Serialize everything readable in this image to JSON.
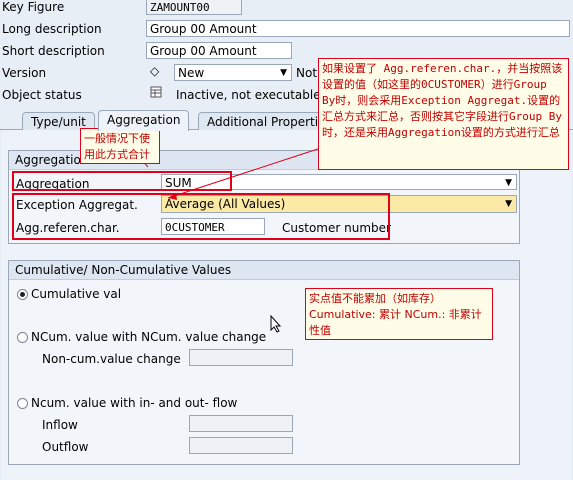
{
  "header": {
    "key_figure_label": "Key Figure",
    "key_figure_value": "ZAMOUNT00",
    "long_desc_label": "Long description",
    "long_desc_value": "Group 00 Amount",
    "short_desc_label": "Short description",
    "short_desc_value": "Group 00 Amount",
    "version_label": "Version",
    "version_value": "New",
    "version_extra": "Not",
    "object_status_label": "Object status",
    "object_status_value": "Inactive, not executable"
  },
  "tabs": [
    {
      "label": "Type/unit"
    },
    {
      "label": "Aggregation"
    },
    {
      "label": "Additional Properties"
    }
  ],
  "aggregation": {
    "title": "Aggregation",
    "aggregation_label": "Aggregation",
    "aggregation_value": "SUM",
    "exception_label": "Exception Aggregat.",
    "exception_value": "Average (All Values)",
    "ref_char_label": "Agg.referen.char.",
    "ref_char_value": "0CUSTOMER",
    "ref_char_desc": "Customer number"
  },
  "cumulative": {
    "title": "Cumulative/ Non-Cumulative Values",
    "option1": "Cumulative val",
    "option2": "NCum. value with NCum. value change",
    "noncum_change_label": "Non-cum.value change",
    "option3": "Ncum. value with in- and out- flow",
    "inflow_label": "Inflow",
    "outflow_label": "Outflow",
    "selected": "Cumulative val"
  },
  "notes": {
    "top": "如果设置了 Agg.referen.char.，并当按照该设置的值（如这里的0CUSTOMER）进行Group By时，则会采用Exception Aggregat.设置的汇总方式来汇总，否则按其它字段进行Group By时，还是采用Aggregation设置的方式进行汇总",
    "left": "一般情况下使用此方式合计",
    "cum": "实点值不能累加（如库存）Cumulative: 累计 NCum.: 非累计性值"
  },
  "icons": {
    "version": "diamond-icon",
    "status": "status-table-icon",
    "dropdown": "chevron-down-icon"
  },
  "colors": {
    "annotation": "#e0001a",
    "highlight_field": "#fbe9a6"
  }
}
